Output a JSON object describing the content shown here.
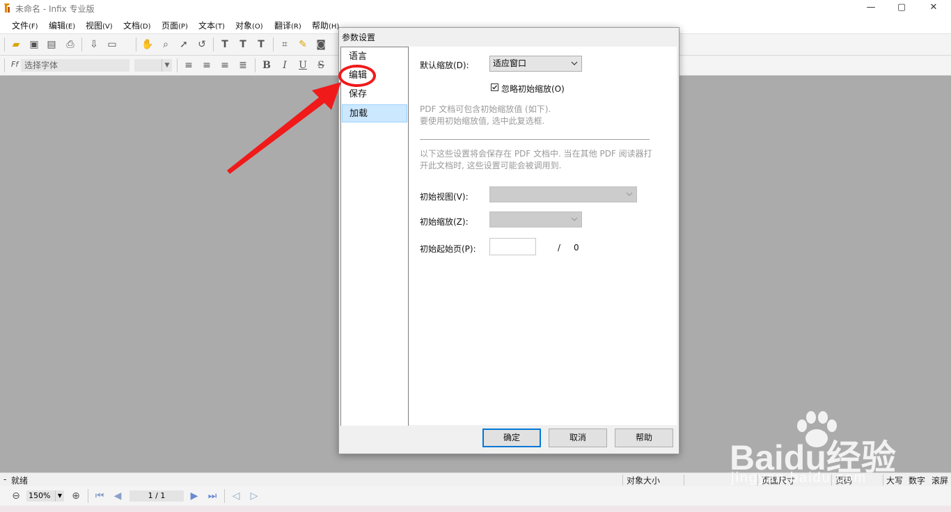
{
  "window": {
    "title": "未命名 - Infix 专业版",
    "buttons": [
      "—",
      "▢",
      "✕"
    ]
  },
  "menu": [
    {
      "label": "文件",
      "key": "(F)"
    },
    {
      "label": "编辑",
      "key": "(E)"
    },
    {
      "label": "视图",
      "key": "(V)"
    },
    {
      "label": "文档",
      "key": "(D)"
    },
    {
      "label": "页面",
      "key": "(P)"
    },
    {
      "label": "文本",
      "key": "(T)"
    },
    {
      "label": "对象",
      "key": "(O)"
    },
    {
      "label": "翻译",
      "key": "(R)"
    },
    {
      "label": "帮助",
      "key": "(H)"
    }
  ],
  "toolbar2": {
    "font_placeholder": "选择字体",
    "font_icon": "Ff",
    "format_buttons": [
      "B",
      "I",
      "U",
      "S"
    ]
  },
  "dialog": {
    "title": "参数设置",
    "categories": [
      "语言",
      "编辑",
      "保存",
      "加载"
    ],
    "selected_category": "加载",
    "default_zoom_label": "默认缩放(D):",
    "default_zoom_value": "适应窗口",
    "ignore_checkbox_label": "忽略初始缩放(O)",
    "ignore_checked": true,
    "note1_line1": "PDF 文档可包含初始缩放值 (如下).",
    "note1_line2": "要使用初始缩放值, 选中此复选框.",
    "note2_line1": "以下这些设置将会保存在 PDF 文档中. 当在其他 PDF 阅读器打",
    "note2_line2": "开此文档时, 这些设置可能会被调用到.",
    "initial_view_label": "初始视图(V):",
    "initial_zoom_label": "初始缩放(Z):",
    "initial_page_label": "初始起始页(P):",
    "initial_page_value": "",
    "page_sep": "/",
    "page_total": "0",
    "buttons": {
      "ok": "确定",
      "cancel": "取消",
      "help": "帮助"
    }
  },
  "statusbar": {
    "ready": "就绪",
    "dash": "-",
    "object_size": "对象大小",
    "page_size": "页面尺寸",
    "page_label": "页码",
    "caps": "大写",
    "num": "数字",
    "scroll": "滚屏"
  },
  "navbar": {
    "zoom": "150%",
    "page": "1 / 1"
  },
  "watermark": {
    "brand": "Baidu经验",
    "url": "jingyan.baidu.com"
  },
  "colors": {
    "accent": "#0078d7",
    "annotation": "#f01a1a",
    "selection": "#cce8ff"
  }
}
